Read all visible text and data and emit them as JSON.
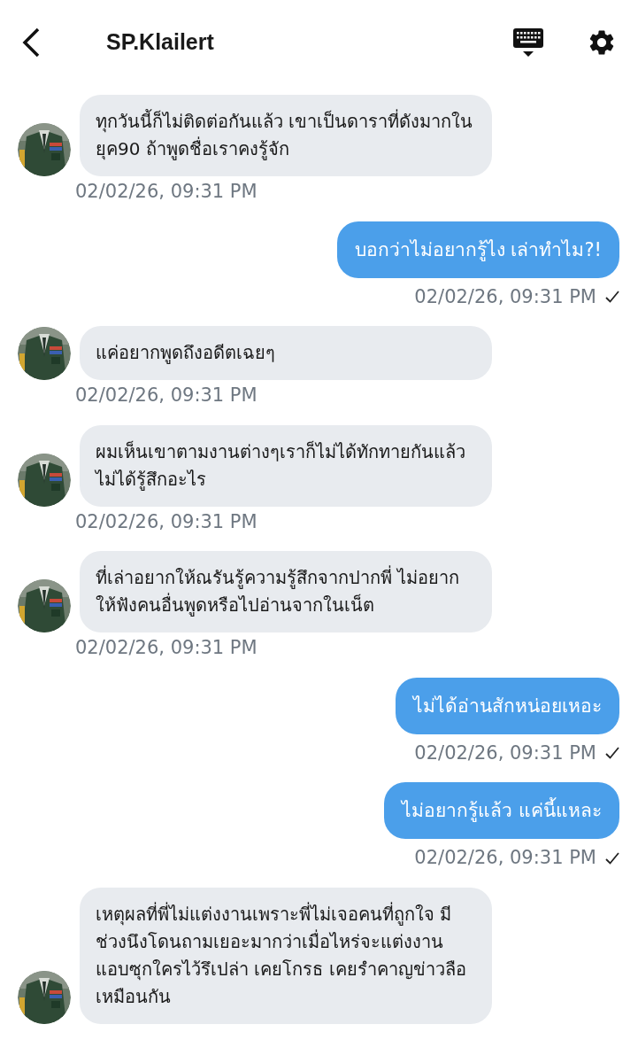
{
  "header": {
    "title": "SP.Klailert"
  },
  "messages": [
    {
      "kind": "received",
      "text": "ทุกวันนี้ก็ไม่ติดต่อกันแล้ว เขาเป็นดาราที่ดังมากในยุค90 ถ้าพูดชื่อเราคงรู้จัก",
      "time": "02/02/26, 09:31 PM"
    },
    {
      "kind": "sent",
      "text": "บอกว่าไม่อยากรู้ไง เล่าทำไม?!",
      "time": "02/02/26, 09:31 PM",
      "read": true
    },
    {
      "kind": "received",
      "text": "แค่อยากพูดถึงอดีตเฉยๆ",
      "time": "02/02/26, 09:31 PM"
    },
    {
      "kind": "received",
      "text": "ผมเห็นเขาตามงานต่างๆเราก็ไม่ได้ทักทายกันแล้ว ไม่ได้รู้สึกอะไร",
      "time": "02/02/26, 09:31 PM"
    },
    {
      "kind": "received",
      "text": "ที่เล่าอยากให้ณรันรู้ความรู้สึกจากปากพี่ ไม่อยากให้ฟังคนอื่นพูดหรือไปอ่านจากในเน็ต",
      "time": "02/02/26, 09:31 PM"
    },
    {
      "kind": "sent",
      "text": "ไม่ได้อ่านสักหน่อยเหอะ",
      "time": "02/02/26, 09:31 PM",
      "read": true
    },
    {
      "kind": "sent",
      "text": "ไม่อยากรู้แล้ว แค่นี้แหละ",
      "time": "02/02/26, 09:31 PM",
      "read": true
    },
    {
      "kind": "received",
      "text": "เหตุผลที่พี่ไม่แต่งงานเพราะพี่ไม่เจอคนที่ถูกใจ มีช่วงนึงโดนถามเยอะมากว่าเมื่อไหร่จะแต่งงาน แอบซุกใครไว้รึเปล่า เคยโกรธ เคยรำคาญข่าวลือเหมือนกัน"
    }
  ]
}
